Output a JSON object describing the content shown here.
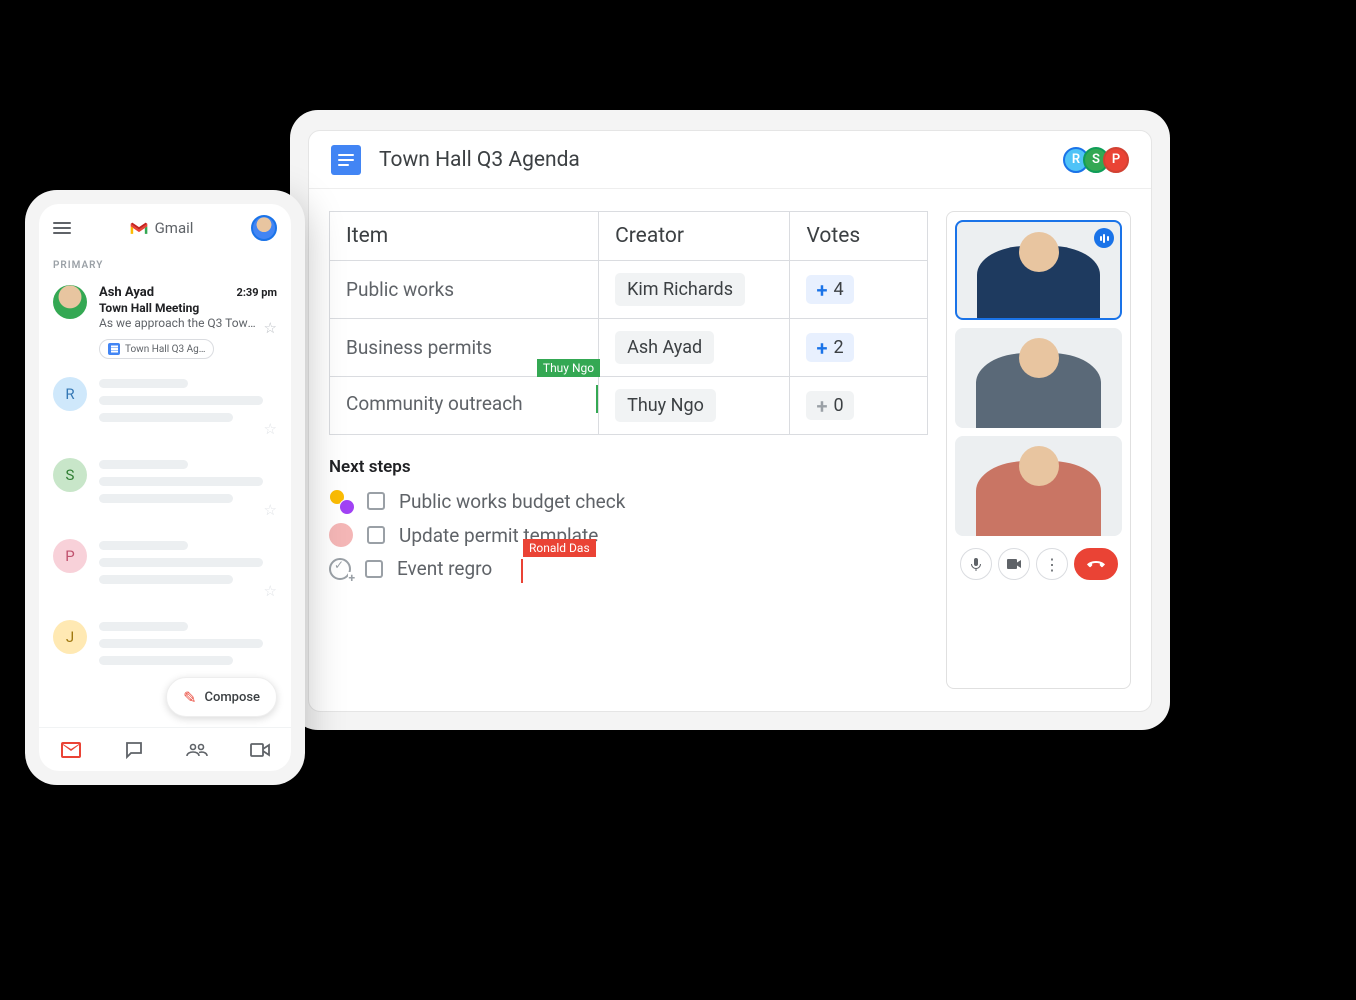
{
  "laptop": {
    "doc_title": "Town Hall Q3 Agenda",
    "collaborators": [
      {
        "initial": "R"
      },
      {
        "initial": "S"
      },
      {
        "initial": "P"
      }
    ],
    "table": {
      "headers": {
        "item": "Item",
        "creator": "Creator",
        "votes": "Votes"
      },
      "rows": [
        {
          "item": "Public works",
          "creator": "Kim Richards",
          "votes": "4"
        },
        {
          "item": "Business permits",
          "creator": "Ash Ayad",
          "votes": "2"
        },
        {
          "item": "Community outreach",
          "creator": "Thuy Ngo",
          "votes": "0"
        }
      ]
    },
    "cursor_green_label": "Thuy Ngo",
    "cursor_red_label": "Ronald Das",
    "next_steps": {
      "title": "Next steps",
      "items": [
        {
          "text": "Public works budget check"
        },
        {
          "text": "Update permit template"
        },
        {
          "text": "Event regro"
        }
      ]
    }
  },
  "phone": {
    "app_name": "Gmail",
    "section_label": "PRIMARY",
    "first_email": {
      "sender": "Ash Ayad",
      "time": "2:39 pm",
      "subject": "Town Hall Meeting",
      "preview": "As we approach the Q3 Town Ha…",
      "attachment_chip": "Town Hall Q3 Ag…"
    },
    "placeholders": [
      {
        "initial": "R"
      },
      {
        "initial": "S"
      },
      {
        "initial": "P"
      },
      {
        "initial": "J"
      }
    ],
    "compose_label": "Compose"
  }
}
